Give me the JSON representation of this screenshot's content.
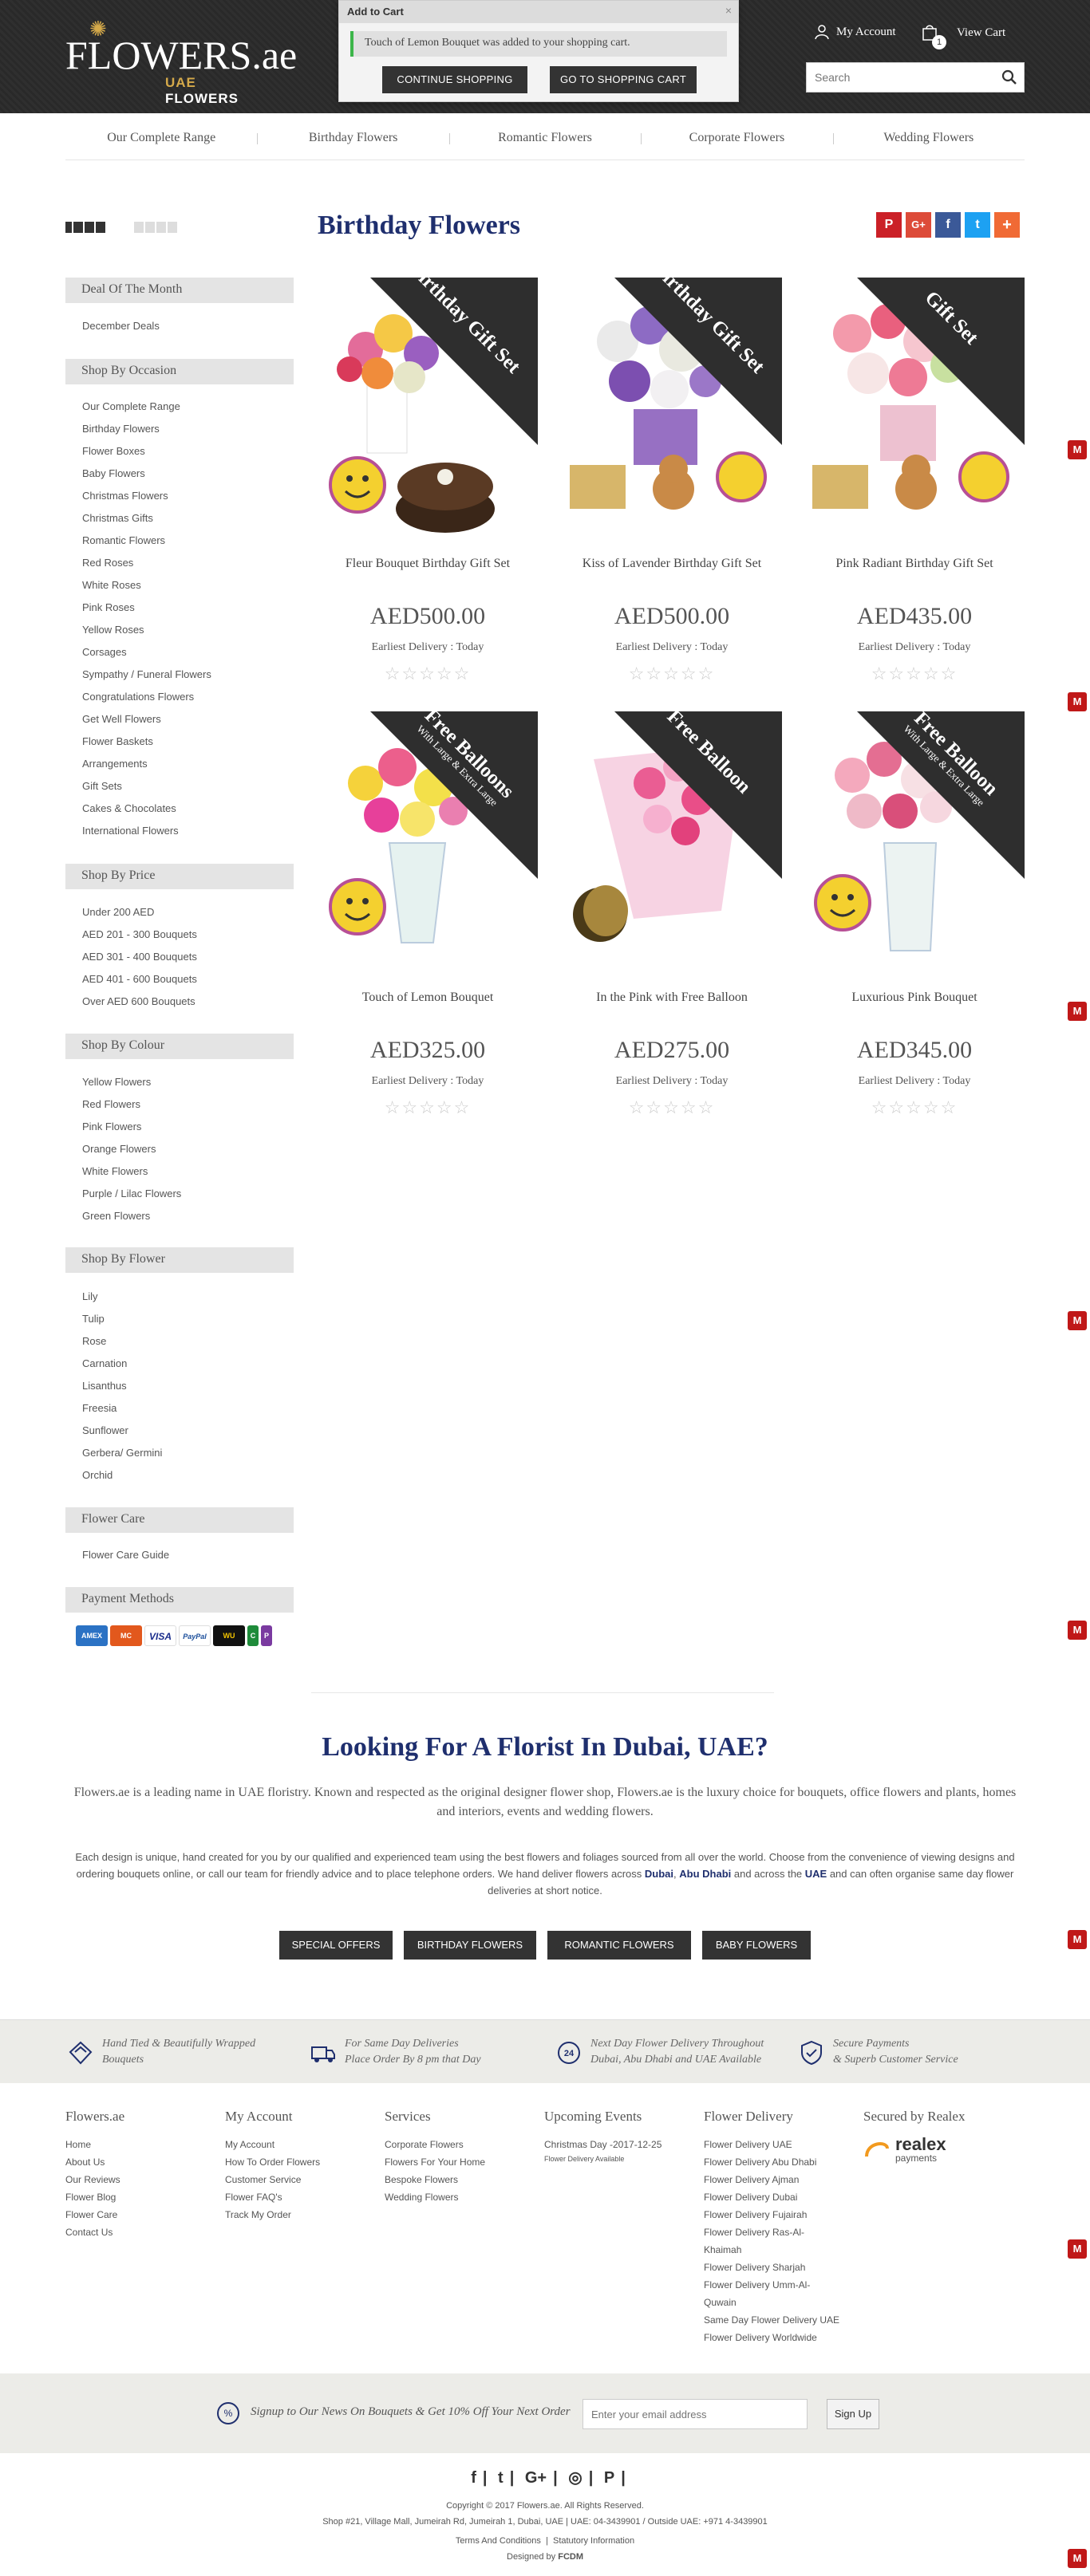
{
  "header": {
    "logo_main": "FLOWERS.ae",
    "logo_uae": "UAE",
    "logo_flowers": "FLOWERS",
    "my_account": "My Account",
    "view_cart": "View Cart",
    "cart_count": "1",
    "search_placeholder": "Search"
  },
  "popup": {
    "title": "Add to Cart",
    "close": "×",
    "message": "Touch of Lemon Bouquet was added to your shopping cart.",
    "continue": "CONTINUE SHOPPING",
    "go_cart": "GO TO SHOPPING CART"
  },
  "nav": [
    "Our Complete Range",
    "Birthday Flowers",
    "Romantic Flowers",
    "Corporate Flowers",
    "Wedding Flowers"
  ],
  "sidebar": {
    "deal": {
      "title": "Deal Of The Month",
      "items": [
        "December Deals"
      ]
    },
    "occasion": {
      "title": "Shop By Occasion",
      "items": [
        "Our Complete Range",
        "Birthday Flowers",
        "Flower Boxes",
        "Baby Flowers",
        "Christmas Flowers",
        "Christmas Gifts",
        "Romantic Flowers",
        "Red Roses",
        "White Roses",
        "Pink Roses",
        "Yellow Roses",
        "Corsages",
        "Sympathy / Funeral Flowers",
        "Congratulations Flowers",
        "Get Well Flowers",
        "Flower Baskets",
        "Arrangements",
        "Gift Sets",
        "Cakes & Chocolates",
        "International Flowers"
      ]
    },
    "price": {
      "title": "Shop By Price",
      "items": [
        "Under 200 AED",
        "AED 201 - 300 Bouquets",
        "AED 301 - 400 Bouquets",
        "AED 401 - 600 Bouquets",
        "Over AED 600 Bouquets"
      ]
    },
    "colour": {
      "title": "Shop By Colour",
      "items": [
        "Yellow Flowers",
        "Red Flowers",
        "Pink Flowers",
        "Orange Flowers",
        "White Flowers",
        "Purple / Lilac Flowers",
        "Green Flowers"
      ]
    },
    "flower": {
      "title": "Shop By Flower",
      "items": [
        "Lily",
        "Tulip",
        "Rose",
        "Carnation",
        "Lisanthus",
        "Freesia",
        "Sunflower",
        "Gerbera/ Germini",
        "Orchid"
      ]
    },
    "care": {
      "title": "Flower Care",
      "items": [
        "Flower Care Guide"
      ]
    },
    "payment": {
      "title": "Payment Methods",
      "icons": [
        "AMEX",
        "MC",
        "VISA",
        "PayPal",
        "WU",
        "C",
        "P"
      ]
    }
  },
  "main": {
    "title": "Birthday Flowers",
    "share": [
      "P",
      "G+",
      "f",
      "t",
      "+"
    ],
    "products": [
      {
        "name": "Fleur Bouquet Birthday Gift Set",
        "price": "AED500.00",
        "delivery": "Earliest Delivery : Today",
        "stars": "☆☆☆☆☆",
        "ribbon": "Birthday Gift Set",
        "ribbon_small": ""
      },
      {
        "name": "Kiss of Lavender Birthday Gift Set",
        "price": "AED500.00",
        "delivery": "Earliest Delivery : Today",
        "stars": "☆☆☆☆☆",
        "ribbon": "Birthday Gift Set",
        "ribbon_small": ""
      },
      {
        "name": "Pink Radiant Birthday Gift Set",
        "price": "AED435.00",
        "delivery": "Earliest Delivery : Today",
        "stars": "☆☆☆☆☆",
        "ribbon": "Gift Set",
        "ribbon_small": ""
      },
      {
        "name": "Touch of Lemon Bouquet",
        "price": "AED325.00",
        "delivery": "Earliest Delivery : Today",
        "stars": "☆☆☆☆☆",
        "ribbon": "Free Balloons",
        "ribbon_small": "With Large & Extra Large"
      },
      {
        "name": "In the Pink with Free Balloon",
        "price": "AED275.00",
        "delivery": "Earliest Delivery : Today",
        "stars": "☆☆☆☆☆",
        "ribbon": "Free Balloon",
        "ribbon_small": ""
      },
      {
        "name": "Luxurious Pink Bouquet",
        "price": "AED345.00",
        "delivery": "Earliest Delivery : Today",
        "stars": "☆☆☆☆☆",
        "ribbon": "Free Balloon",
        "ribbon_small": "With Large & Extra Large"
      }
    ]
  },
  "seo": {
    "title": "Looking For A Florist In Dubai, UAE?",
    "p1": "Flowers.ae is a leading name in UAE floristry. Known and respected as the original designer flower shop, Flowers.ae is the luxury choice for bouquets, office flowers and plants, homes and interiors, events and wedding flowers.",
    "p2_a": "Each design is unique, hand created for you by our qualified and experienced team using the best flowers and foliages sourced from all over the world. Choose from the convenience of viewing designs and ordering bouquets online, or call our team for friendly advice and to place telephone orders. We hand deliver flowers across ",
    "link_dubai": "Dubai",
    "link_abudhabi": "Abu Dhabi",
    "p2_b": " and across the ",
    "link_uae": "UAE",
    "p2_c": " and can often organise same day flower deliveries at short notice.",
    "buttons": [
      "SPECIAL OFFERS",
      "BIRTHDAY FLOWERS",
      "ROMANTIC FLOWERS",
      "BABY FLOWERS"
    ]
  },
  "features": [
    {
      "line1": "Hand Tied & Beautifully Wrapped",
      "line2": "Bouquets"
    },
    {
      "line1": "For Same Day Deliveries",
      "line2": "Place Order By 8 pm that Day"
    },
    {
      "line1": "Next Day Flower Delivery Throughout",
      "line2": "Dubai, Abu Dhabi and UAE Available"
    },
    {
      "line1": "Secure Payments",
      "line2": "& Superb Customer Service"
    }
  ],
  "footer": {
    "cols": [
      {
        "title": "Flowers.ae",
        "items": [
          "Home",
          "About Us",
          "Our Reviews",
          "Flower Blog",
          "Flower Care",
          "Contact Us"
        ]
      },
      {
        "title": "My Account",
        "items": [
          "My Account",
          "How To Order Flowers",
          "Customer Service",
          "Flower FAQ's",
          "Track My Order"
        ]
      },
      {
        "title": "Services",
        "items": [
          "Corporate Flowers",
          "Flowers For Your Home",
          "Bespoke Flowers",
          "Wedding Flowers"
        ]
      },
      {
        "title": "Upcoming Events",
        "items": [
          "Christmas Day -2017-12-25"
        ],
        "note": "Flower Delivery Available"
      },
      {
        "title": "Flower Delivery",
        "items": [
          "Flower Delivery UAE",
          "Flower Delivery Abu Dhabi",
          "Flower Delivery Ajman",
          "Flower Delivery Dubai",
          "Flower Delivery Fujairah",
          "Flower Delivery Ras-Al-Khaimah",
          "Flower Delivery Sharjah",
          "Flower Delivery Umm-Al-Quwain",
          "Same Day Flower Delivery UAE",
          "Flower Delivery Worldwide"
        ]
      },
      {
        "title": "Secured by Realex",
        "items": []
      }
    ],
    "realex": "realex",
    "realex_sub": "payments",
    "newsletter_text": "Signup to Our News On Bouquets & Get 10% Off Your Next Order",
    "newsletter_icon": "%",
    "newsletter_placeholder": "Enter your email address",
    "signup": "Sign Up",
    "social": [
      "f",
      "t",
      "G+",
      "◎",
      "P"
    ],
    "copyright": "Copyright © 2017 Flowers.ae. All Rights Reserved.",
    "address": "Shop #21, Village Mall, Jumeirah Rd, Jumeirah 1, Dubai, UAE | UAE: 04-3439901 / Outside UAE: +971 4-3439901",
    "terms": "Terms And Conditions",
    "statutory": "Statutory Information",
    "designed": "Designed by ",
    "designer": "FCDM"
  },
  "mcafee_label": "M"
}
